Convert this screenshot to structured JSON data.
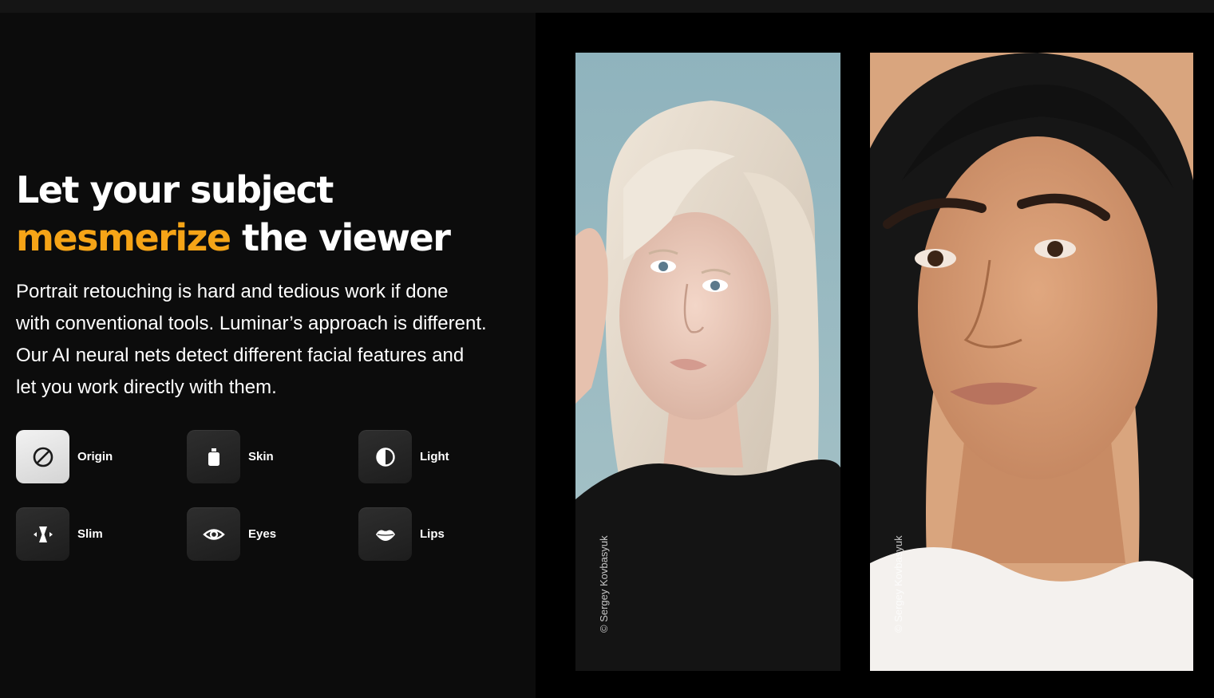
{
  "hero": {
    "title_line1": "Let your subject",
    "title_accent": "mesmerize",
    "title_rest": " the viewer",
    "description": "Portrait retouching is hard and tedious work if done with conventional tools. Luminar’s approach is different. Our AI neural nets detect different facial features and let you work directly with them."
  },
  "tools": [
    {
      "label": "Origin",
      "icon": "origin-icon",
      "active": true
    },
    {
      "label": "Skin",
      "icon": "skin-icon",
      "active": false
    },
    {
      "label": "Light",
      "icon": "light-icon",
      "active": false
    },
    {
      "label": "Slim",
      "icon": "slim-icon",
      "active": false
    },
    {
      "label": "Eyes",
      "icon": "eye-icon",
      "active": false
    },
    {
      "label": "Lips",
      "icon": "lips-icon",
      "active": false
    }
  ],
  "photos": {
    "credit_left": "© Sergey Kovbasyuk",
    "credit_right": "© Sergey Kovbasyuk"
  },
  "colors": {
    "accent": "#f5a417",
    "background": "#0c0c0c",
    "panel": "#000000"
  }
}
